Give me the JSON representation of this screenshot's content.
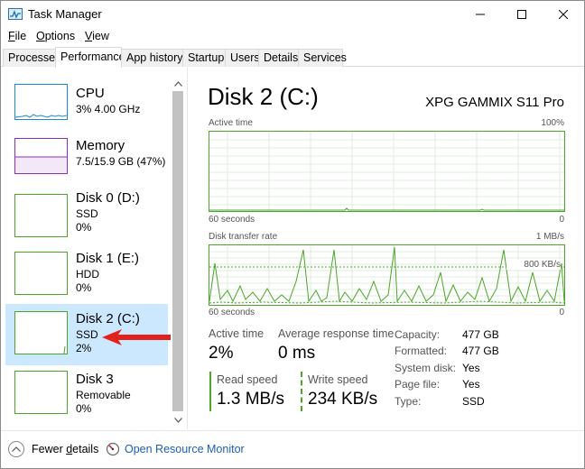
{
  "window": {
    "title": "Task Manager"
  },
  "menu": {
    "file": {
      "key": "F",
      "rest": "ile"
    },
    "options": {
      "key": "O",
      "rest": "ptions"
    },
    "view": {
      "key": "V",
      "rest": "iew"
    }
  },
  "tabs": [
    {
      "label": "Processes",
      "active": false
    },
    {
      "label": "Performance",
      "active": true
    },
    {
      "label": "App history",
      "active": false
    },
    {
      "label": "Startup",
      "active": false
    },
    {
      "label": "Users",
      "active": false
    },
    {
      "label": "Details",
      "active": false
    },
    {
      "label": "Services",
      "active": false
    }
  ],
  "resources": [
    {
      "name": "CPU",
      "sub1": "3%  4.00 GHz",
      "sub2": "",
      "color": "#1a8bd1"
    },
    {
      "name": "Memory",
      "sub1": "7.5/15.9 GB (47%)",
      "sub2": "",
      "color": "#8b2fb8"
    },
    {
      "name": "Disk 0 (D:)",
      "sub1": "SSD",
      "sub2": "0%",
      "color": "#4ca42b"
    },
    {
      "name": "Disk 1 (E:)",
      "sub1": "HDD",
      "sub2": "0%",
      "color": "#4ca42b"
    },
    {
      "name": "Disk 2 (C:)",
      "sub1": "SSD",
      "sub2": "2%",
      "color": "#4ca42b",
      "selected": true
    },
    {
      "name": "Disk 3",
      "sub1": "Removable",
      "sub2": "0%",
      "color": "#4ca42b"
    }
  ],
  "detail": {
    "title": "Disk 2 (C:)",
    "model": "XPG GAMMIX S11 Pro",
    "graph1": {
      "label": "Active time",
      "max": "100%",
      "time": "60 seconds",
      "min": "0"
    },
    "graph2": {
      "label": "Disk transfer rate",
      "max": "1 MB/s",
      "mid": "800 KB/s",
      "time": "60 seconds",
      "min": "0"
    },
    "stats": {
      "active_time_label": "Active time",
      "active_time_value": "2%",
      "avg_response_label": "Average response time",
      "avg_response_value": "0 ms",
      "read_label": "Read speed",
      "read_value": "1.3 MB/s",
      "write_label": "Write speed",
      "write_value": "234 KB/s"
    },
    "properties": [
      {
        "label": "Capacity:",
        "value": "477 GB"
      },
      {
        "label": "Formatted:",
        "value": "477 GB"
      },
      {
        "label": "System disk:",
        "value": "Yes"
      },
      {
        "label": "Page file:",
        "value": "Yes"
      },
      {
        "label": "Type:",
        "value": "SSD"
      }
    ]
  },
  "footer": {
    "fewer_details_key": "d",
    "fewer_details_pre": "Fewer ",
    "fewer_details_post": "etails",
    "open_monitor": "Open Resource Monitor"
  },
  "colors": {
    "accent_green": "#4ca42b",
    "selection": "#cce8ff",
    "arrow_red": "#e0211c",
    "link_blue": "#1a5fb4"
  }
}
